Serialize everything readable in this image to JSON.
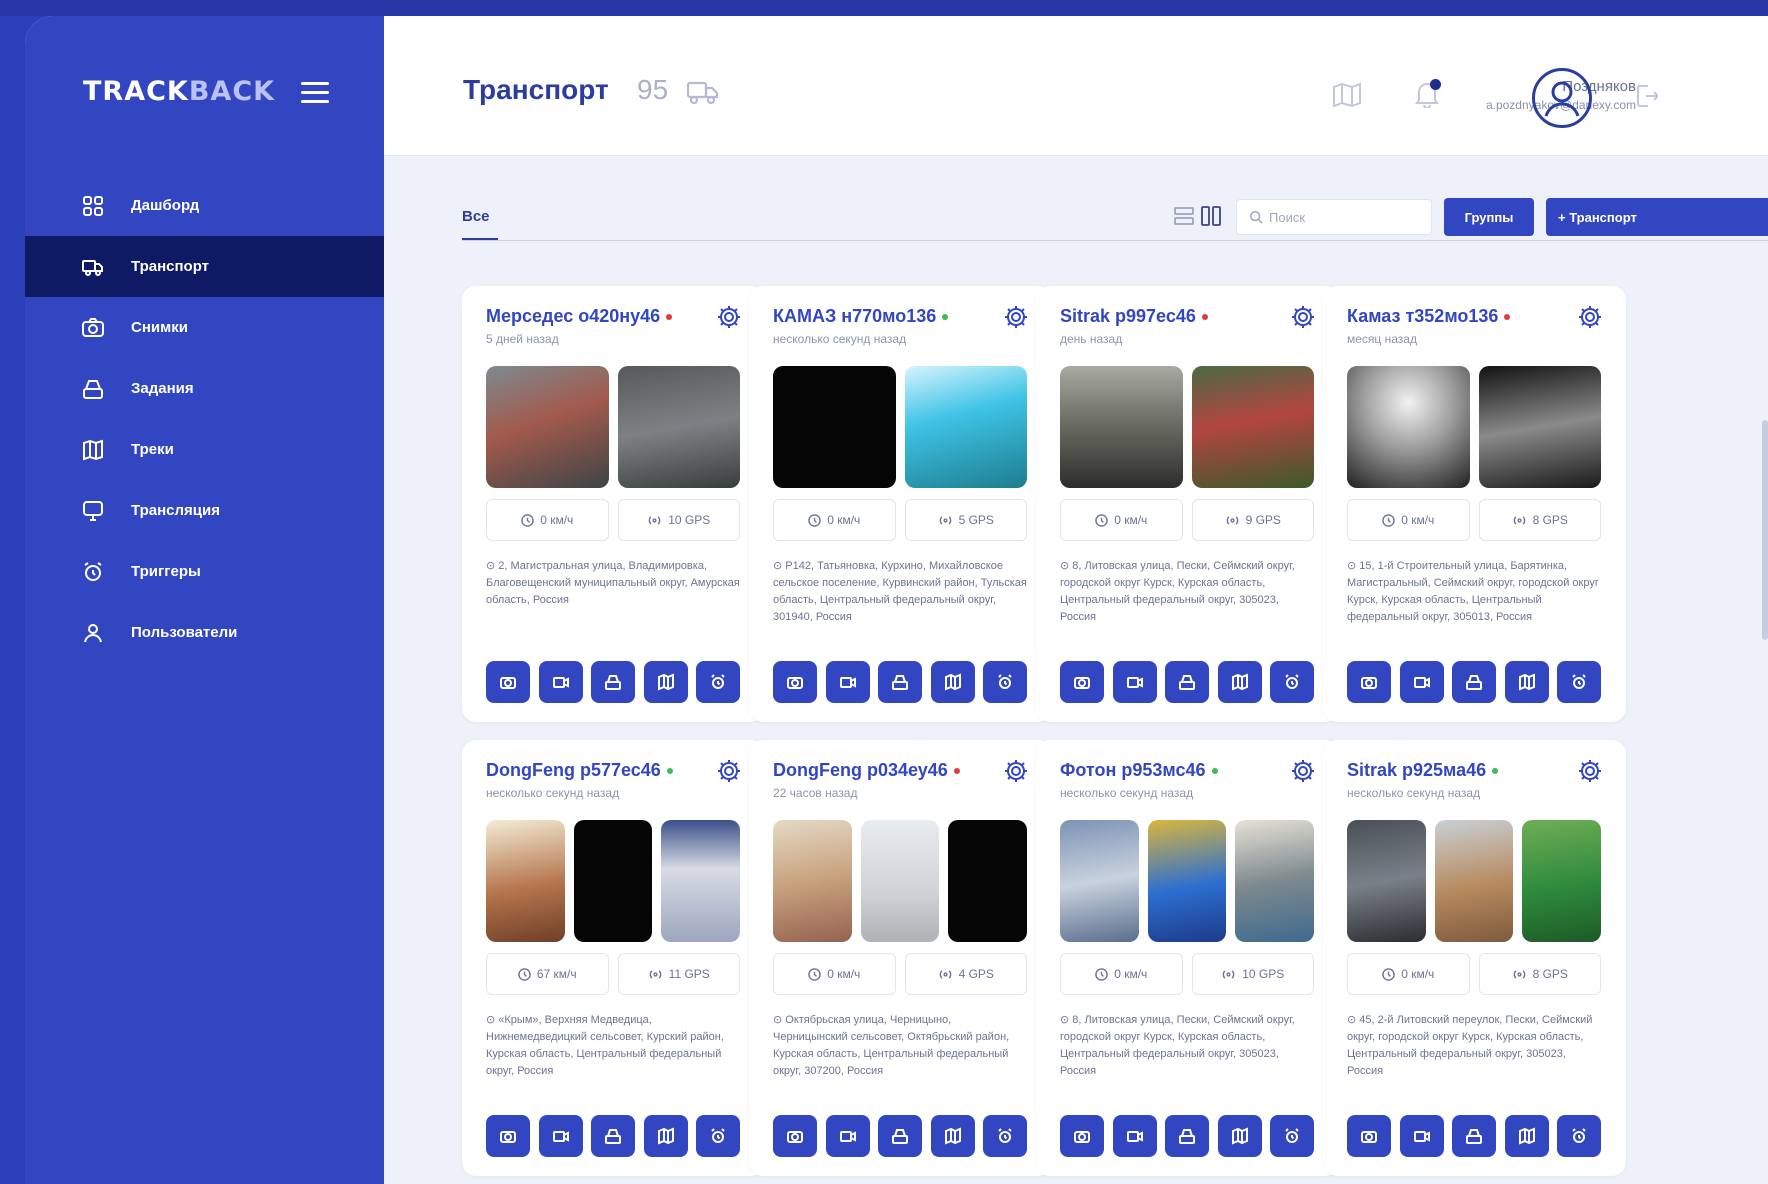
{
  "brand": {
    "part1": "TRACK",
    "part2": "BACK"
  },
  "sidebar": {
    "items": [
      {
        "label": "Дашборд",
        "icon": "dashboard-icon"
      },
      {
        "label": "Транспорт",
        "icon": "truck-icon",
        "active": true
      },
      {
        "label": "Снимки",
        "icon": "camera-icon"
      },
      {
        "label": "Задания",
        "icon": "tasks-icon"
      },
      {
        "label": "Треки",
        "icon": "map-icon"
      },
      {
        "label": "Трансляция",
        "icon": "broadcast-icon"
      },
      {
        "label": "Триггеры",
        "icon": "alarm-icon"
      },
      {
        "label": "Пользователи",
        "icon": "user-icon"
      }
    ]
  },
  "header": {
    "title": "Транспорт",
    "count": "95",
    "user_name": "Поздняков",
    "user_email": "a.pozdnyakov@danexy.com"
  },
  "toolbar": {
    "tab_all": "Все",
    "search_placeholder": "Поиск",
    "groups_label": "Группы",
    "add_label": "+ Транспорт"
  },
  "colors": {
    "accent": "#3346c2",
    "dark": "#0e1a63",
    "online": "#3dbb5a",
    "offline": "#e23b3b"
  },
  "vehicles": [
    {
      "name": "Мерседес о420ну46",
      "status": "offline",
      "updated": "5 дней назад",
      "speed": "0 км/ч",
      "gps": "10 GPS",
      "address": "2, Магистральная улица, Владимировка, Благовещенский муниципальный округ, Амурская область, Россия"
    },
    {
      "name": "КАМАЗ н770мо136",
      "status": "online",
      "updated": "несколько секунд назад",
      "speed": "0 км/ч",
      "gps": "5 GPS",
      "address": "Р142, Татьяновка, Курхино, Михайловское сельское поселение, Курвинский район, Тульская область, Центральный федеральный округ, 301940, Россия"
    },
    {
      "name": "Sitrak р997ес46",
      "status": "offline",
      "updated": "день назад",
      "speed": "0 км/ч",
      "gps": "9 GPS",
      "address": "8, Литовская улица, Пески, Сеймский округ, городской округ Курск, Курская область, Центральный федеральный округ, 305023, Россия"
    },
    {
      "name": "Камаз т352мо136",
      "status": "offline",
      "updated": "месяц назад",
      "speed": "0 км/ч",
      "gps": "8 GPS",
      "address": "15, 1-й Строительный улица, Барятинка, Магистральный, Сеймский округ, городской округ Курск, Курская область, Центральный федеральный округ, 305013, Россия"
    },
    {
      "name": "DongFeng р577ес46",
      "status": "online",
      "updated": "несколько секунд назад",
      "speed": "67 км/ч",
      "gps": "11 GPS",
      "address": "«Крым», Верхняя Медведица, Нижнемедведицкий сельсовет, Курский район, Курская область, Центральный федеральный округ, Россия"
    },
    {
      "name": "DongFeng р034еу46",
      "status": "offline",
      "updated": "22 часов назад",
      "speed": "0 км/ч",
      "gps": "4 GPS",
      "address": "Октябрьская улица, Черницыно, Черницынский сельсовет, Октябрьский район, Курская область, Центральный федеральный округ, 307200, Россия"
    },
    {
      "name": "Фотон р953мс46",
      "status": "online",
      "updated": "несколько секунд назад",
      "speed": "0 км/ч",
      "gps": "10 GPS",
      "address": "8, Литовская улица, Пески, Сеймский округ, городской округ Курск, Курская область, Центральный федеральный округ, 305023, Россия"
    },
    {
      "name": "Sitrak р925ма46",
      "status": "online",
      "updated": "несколько секунд назад",
      "speed": "0 км/ч",
      "gps": "8 GPS",
      "address": "45, 2-й Литовский переулок, Пески, Сеймский округ, городской округ Курск, Курская область, Центральный федеральный округ, 305023, Россия"
    }
  ]
}
